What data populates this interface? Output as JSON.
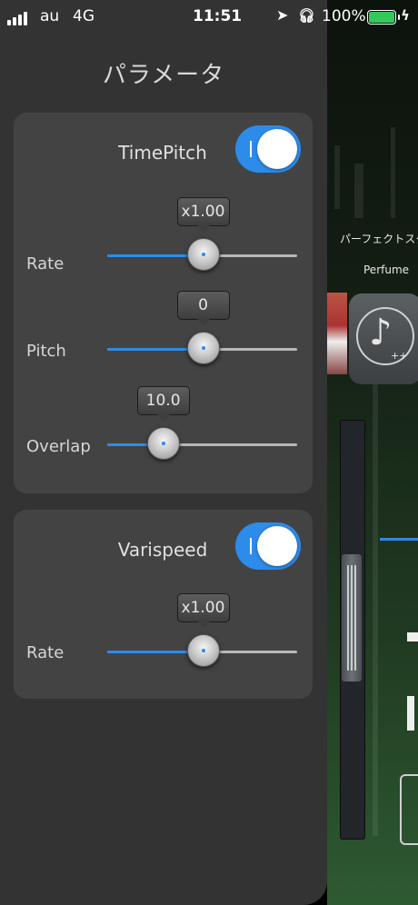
{
  "status_bar": {
    "carrier": "au",
    "network": "4G",
    "time": "11:51",
    "battery_percent": "100%",
    "signal_bars": 4,
    "battery_color": "#34c759"
  },
  "panel": {
    "title": "パラメータ"
  },
  "timepitch": {
    "title": "TimePitch",
    "enabled": true,
    "sliders": [
      {
        "label": "Rate",
        "value_text": "x1.00",
        "fraction": 0.5
      },
      {
        "label": "Pitch",
        "value_text": "0",
        "fraction": 0.5
      },
      {
        "label": "Overlap",
        "value_text": "10.0",
        "fraction": 0.29
      }
    ]
  },
  "varispeed": {
    "title": "Varispeed",
    "enabled": true,
    "sliders": [
      {
        "label": "Rate",
        "value_text": "x1.00",
        "fraction": 0.5
      }
    ]
  },
  "behind_player": {
    "song_title": "パーフェクトスタ",
    "artist": "Perfume"
  },
  "colors": {
    "accent": "#2d8be9",
    "panel_bg": "#333333",
    "card_bg": "#434343"
  },
  "icons": [
    "location-icon",
    "headphones-icon",
    "battery-icon",
    "charging-bolt-icon",
    "music-note-icon"
  ]
}
